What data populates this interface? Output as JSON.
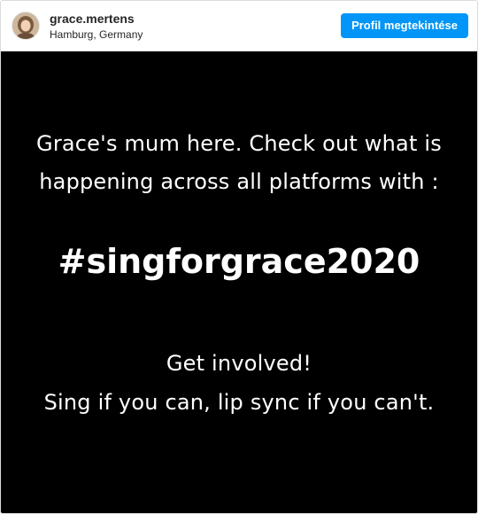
{
  "header": {
    "username": "grace.mertens",
    "location": "Hamburg, Germany",
    "view_profile_label": "Profil megtekintése"
  },
  "post": {
    "line1": "Grace's mum here. Check out what is",
    "line2": "happening across all platforms with :",
    "hashtag": "#singforgrace2020",
    "line3": "Get involved!",
    "line4": "Sing if you can, lip sync if you can't.",
    "background_color": "#000000",
    "text_color": "#ffffff"
  },
  "colors": {
    "button": "#0095f6",
    "text": "#262626"
  }
}
